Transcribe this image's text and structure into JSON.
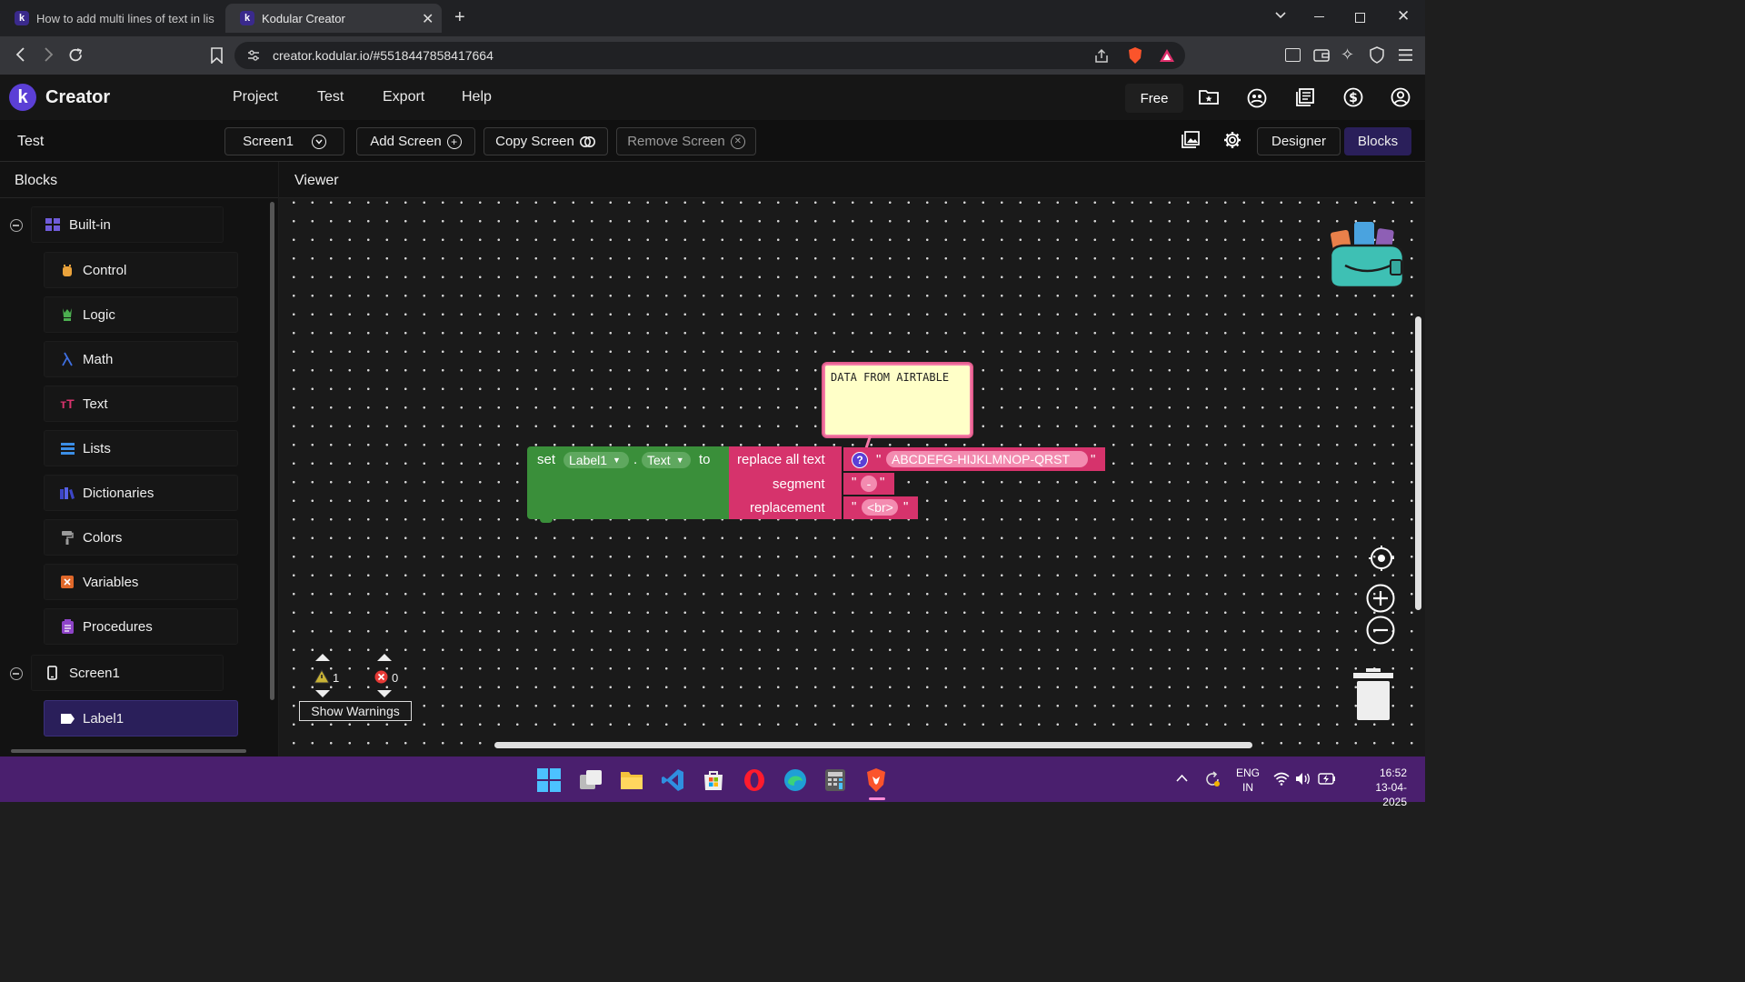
{
  "browser": {
    "tabs": [
      {
        "title": "How to add multi lines of text in list",
        "active": false
      },
      {
        "title": "Kodular Creator",
        "active": true
      }
    ],
    "url": "creator.kodular.io/#5518447858417664"
  },
  "app": {
    "brand": "Creator",
    "menu": [
      "Project",
      "Test",
      "Export",
      "Help"
    ],
    "plan_badge": "Free"
  },
  "toolbar": {
    "project_name": "Test",
    "screen_selector": "Screen1",
    "add_screen": "Add Screen",
    "copy_screen": "Copy Screen",
    "remove_screen": "Remove Screen",
    "designer": "Designer",
    "blocks": "Blocks"
  },
  "blocks_panel": {
    "title": "Blocks",
    "builtin_label": "Built-in",
    "categories": [
      "Control",
      "Logic",
      "Math",
      "Text",
      "Lists",
      "Dictionaries",
      "Colors",
      "Variables",
      "Procedures"
    ],
    "screen_label": "Screen1",
    "components": [
      "Label1"
    ]
  },
  "viewer": {
    "title": "Viewer",
    "comment_text": "DATA FROM AIRTABLE",
    "set_block": {
      "set": "set",
      "component": "Label1",
      "dot": ".",
      "property": "Text",
      "to": "to"
    },
    "replace_block": {
      "label": "replace all text",
      "segment_label": "segment",
      "replacement_label": "replacement",
      "text_value": "ABCDEFG-HIJKLMNOP-QRST",
      "segment_value": "-",
      "replacement_value": "<br>",
      "quote": "\""
    },
    "warnings_count": "1",
    "errors_count": "0",
    "show_warnings": "Show Warnings"
  },
  "taskbar": {
    "lang_line1": "ENG",
    "lang_line2": "IN",
    "time": "16:52",
    "date": "13-04-2025"
  },
  "colors": {
    "set_block": "#3a8f3a",
    "text_block": "#d6336c",
    "accent": "#5b3fd6"
  }
}
